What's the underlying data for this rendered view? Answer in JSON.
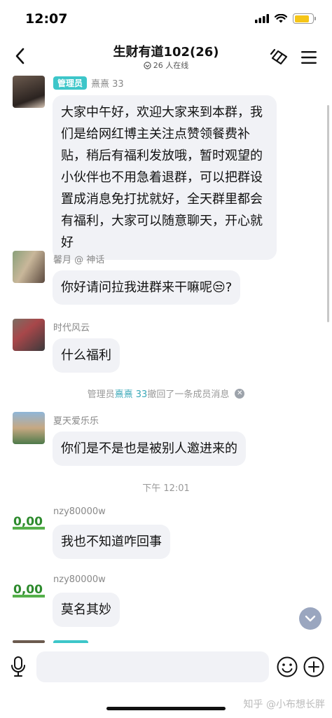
{
  "status_bar": {
    "time": "12:07",
    "battery_percent": 80,
    "battery_color": "#f5c518"
  },
  "nav": {
    "title": "生财有道102(26)",
    "online_text": "26 人在线",
    "back_icon": "chevron-left-icon",
    "actions": [
      "group-share-icon",
      "menu-icon"
    ]
  },
  "messages": [
    {
      "sender": "熹熹 33",
      "badge": "管理员",
      "text": "大家中午好，欢迎大家来到本群，我们是给网红博主关注点赞领餐费补贴，稍后有福利发放哦，暂时观望的小伙伴也不用急着退群，可以把群设置成消息免打扰就好，全天群里都会有福利，大家可以随意聊天，开心就好"
    },
    {
      "sender": "馨月 @ 神话",
      "text": "你好请问拉我进群来干嘛呢😒?"
    },
    {
      "sender": "时代风云",
      "text": "什么福利"
    },
    {
      "sender": "夏天爱乐乐",
      "text": "你们是不是也是被别人邀进来的"
    },
    {
      "sender": "nzy80000w",
      "text": "我也不知道咋回事"
    },
    {
      "sender": "nzy80000w",
      "text": "莫名其妙"
    }
  ],
  "system_notice": {
    "prefix": "管理员",
    "name": "熹熹 33",
    "suffix": "撤回了一条成员消息",
    "close_icon": "close-circle-icon"
  },
  "time_separator": "下午 12:01",
  "input": {
    "placeholder": "",
    "icons": [
      "mic-icon",
      "emoji-icon",
      "plus-icon"
    ]
  },
  "watermark": "知乎 @小布想长胖",
  "colors": {
    "accent": "#3dc6c9",
    "bubble": "#f1f2f6",
    "scroll_button": "#9aa6bf"
  }
}
